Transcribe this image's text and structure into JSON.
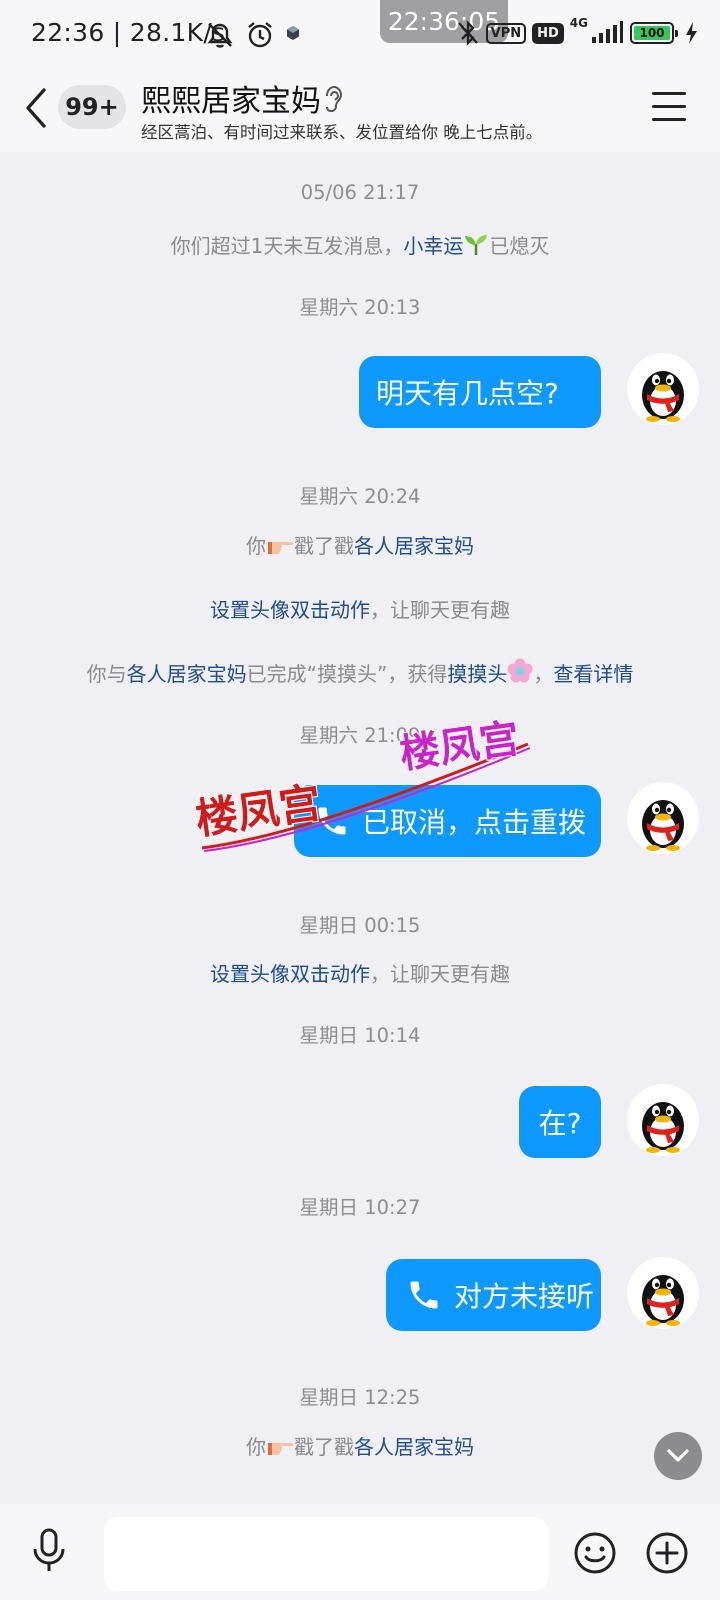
{
  "status_bar": {
    "time": "22:36",
    "net_speed": "28.1K/s",
    "floating_time": "22:36:05",
    "vpn": "VPN",
    "hd": "HD",
    "network": "4G",
    "battery": "100"
  },
  "header": {
    "unread_count": "99+",
    "title": "熙熙居家宝妈",
    "subtitle": "经区蒿泊、有时间过来联系、发位置给你 晚上七点前。"
  },
  "chat": {
    "t1": "05/06 21:17",
    "sys1": {
      "pre": "你们超过1天未互发消息，",
      "link": "小幸运",
      "post": "已熄灭"
    },
    "t2": "星期六 20:13",
    "msg1": "明天有几点空?",
    "t3": "星期六 20:24",
    "poke1": {
      "pre": "你",
      "post": "戳了戳",
      "link": "各人居家宝妈"
    },
    "tip1": {
      "link": "设置头像双击动作",
      "post": "，让聊天更有趣"
    },
    "achieve": {
      "pre": "你与",
      "link1": "各人居家宝妈",
      "mid": "已完成“摸摸头”，获得",
      "link2": "摸摸头",
      "sep": "，",
      "link3": "查看详情"
    },
    "t4": "星期六 21:09",
    "call1": "已取消，点击重拨",
    "t5": "星期日 00:15",
    "tip2": {
      "link": "设置头像双击动作",
      "post": "，让聊天更有趣"
    },
    "t6": "星期日 10:14",
    "msg2": "在?",
    "t7": "星期日 10:27",
    "call2": "对方未接听",
    "t8": "星期日 12:25",
    "poke2": {
      "pre": "你",
      "post": "戳了戳",
      "link": "各人居家宝妈"
    }
  },
  "watermark": "楼凤宫",
  "input": {
    "value": "",
    "placeholder": ""
  },
  "colors": {
    "bubble": "#0d99ff",
    "link": "#1f4e8f",
    "background": "#efeff4",
    "watermark_red": "#d21a1a",
    "watermark_magenta": "#cc22cc"
  }
}
